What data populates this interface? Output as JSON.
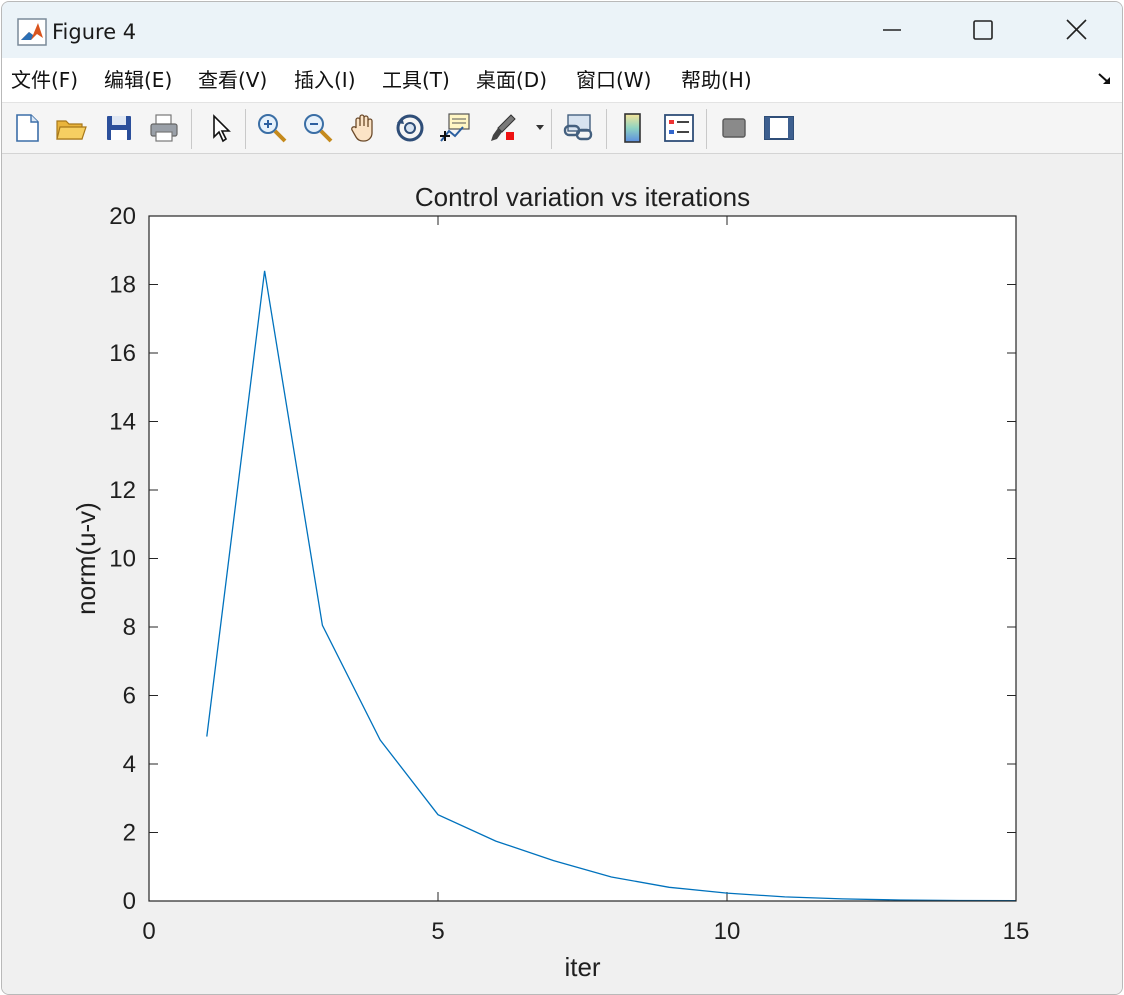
{
  "window": {
    "title": "Figure 4",
    "icon": "matlab-icon",
    "controls": [
      "minimize-icon",
      "maximize-icon",
      "close-icon"
    ]
  },
  "menu": {
    "items": [
      {
        "label": "文件(F)"
      },
      {
        "label": "编辑(E)"
      },
      {
        "label": "查看(V)"
      },
      {
        "label": "插入(I)"
      },
      {
        "label": "工具(T)"
      },
      {
        "label": "桌面(D)"
      },
      {
        "label": "窗口(W)"
      },
      {
        "label": "帮助(H)"
      }
    ],
    "dock_icon": "dock-arrow-icon"
  },
  "toolbar": {
    "tools": [
      "new-figure-icon",
      "open-file-icon",
      "save-icon",
      "print-icon",
      "edit-plot-icon",
      "zoom-in-icon",
      "zoom-out-icon",
      "pan-icon",
      "rotate-3d-icon",
      "data-cursor-icon",
      "brush-icon",
      "link-plot-icon",
      "colorbar-icon",
      "legend-icon",
      "hide-plot-tools-icon",
      "show-plot-tools-icon"
    ]
  },
  "chart_data": {
    "type": "line",
    "title": "Control variation vs iterations",
    "xlabel": "iter",
    "ylabel": "norm(u-v)",
    "xlim": [
      0,
      15
    ],
    "ylim": [
      0,
      20
    ],
    "xticks": [
      0,
      5,
      10,
      15
    ],
    "yticks": [
      0,
      2,
      4,
      6,
      8,
      10,
      12,
      14,
      16,
      18,
      20
    ],
    "grid": false,
    "series": [
      {
        "color": "#0072bd",
        "x": [
          1,
          2,
          3,
          4,
          5,
          6,
          7,
          8,
          9,
          10,
          11,
          12,
          13,
          14,
          15
        ],
        "y": [
          4.8,
          18.4,
          8.05,
          4.7,
          2.52,
          1.75,
          1.18,
          0.7,
          0.4,
          0.23,
          0.12,
          0.06,
          0.03,
          0.015,
          0.008
        ]
      }
    ]
  }
}
